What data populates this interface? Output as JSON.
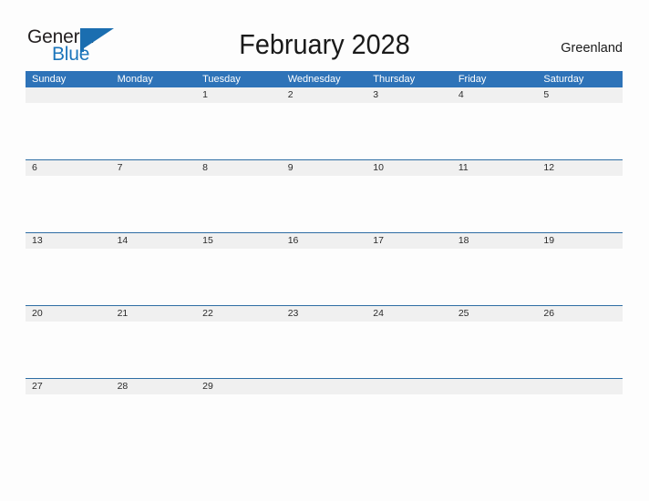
{
  "logo": {
    "word_one": "General",
    "word_two": "Blue",
    "flag_icon": "flag-triangle-icon"
  },
  "header": {
    "title": "February 2028",
    "country": "Greenland"
  },
  "colors": {
    "header_blue": "#2e73b8",
    "rule_blue": "#2e6da4",
    "date_strip": "#f0f0f0",
    "logo_blue": "#1b75bb",
    "page_background": "#fdfdfd"
  },
  "calendar": {
    "day_headers": [
      "Sunday",
      "Monday",
      "Tuesday",
      "Wednesday",
      "Thursday",
      "Friday",
      "Saturday"
    ],
    "weeks": [
      [
        "",
        "",
        "1",
        "2",
        "3",
        "4",
        "5"
      ],
      [
        "6",
        "7",
        "8",
        "9",
        "10",
        "11",
        "12"
      ],
      [
        "13",
        "14",
        "15",
        "16",
        "17",
        "18",
        "19"
      ],
      [
        "20",
        "21",
        "22",
        "23",
        "24",
        "25",
        "26"
      ],
      [
        "27",
        "28",
        "29",
        "",
        "",
        "",
        ""
      ]
    ]
  }
}
